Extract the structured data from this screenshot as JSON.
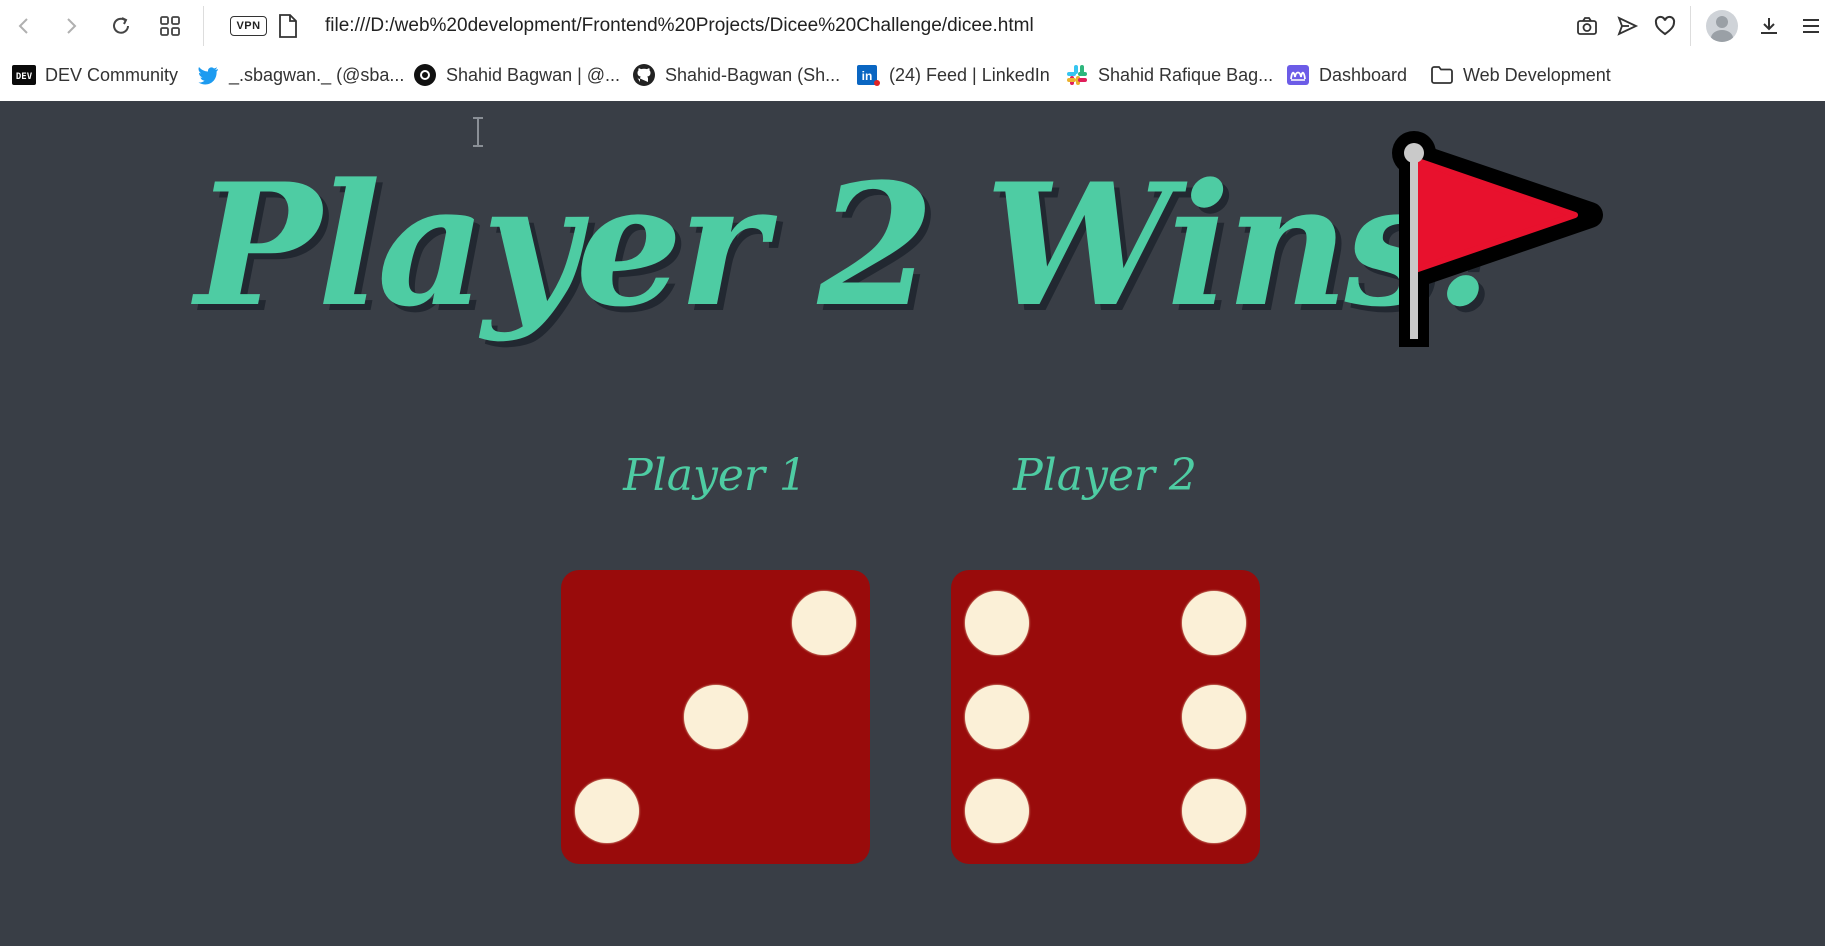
{
  "browser": {
    "address_url": "file:///D:/web%20development/Frontend%20Projects/Dicee%20Challenge/dicee.html",
    "vpn_label": "VPN",
    "icons": [
      "back-icon",
      "forward-icon",
      "reload-icon",
      "speed-dial-icon",
      "vpn-icon",
      "page-info-icon",
      "camera-icon",
      "send-icon",
      "heart-icon",
      "avatar",
      "download-icon",
      "menu-icon"
    ]
  },
  "bookmarks": [
    {
      "label": "DEV Community",
      "icon": "dev-icon"
    },
    {
      "label": "_.sbagwan._ (@sba...",
      "icon": "twitter-icon"
    },
    {
      "label": "Shahid Bagwan | @...",
      "icon": "hashnode-icon"
    },
    {
      "label": "Shahid-Bagwan (Sh...",
      "icon": "github-icon"
    },
    {
      "label": "(24) Feed | LinkedIn",
      "icon": "linkedin-icon"
    },
    {
      "label": "Shahid Rafique Bag...",
      "icon": "slack-icon"
    },
    {
      "label": "Dashboard",
      "icon": "dashboard-icon"
    },
    {
      "label": "Web Development",
      "icon": "folder-icon"
    }
  ],
  "game": {
    "title": "Player 2 Wins!",
    "player1": {
      "label": "Player 1",
      "die_value": 3
    },
    "player2": {
      "label": "Player 2",
      "die_value": 6
    }
  },
  "colors": {
    "background": "#393e46",
    "accent": "#4ecca3",
    "die": "#990b0b",
    "pip": "#fbf0d7",
    "flag": "#e8112d"
  }
}
